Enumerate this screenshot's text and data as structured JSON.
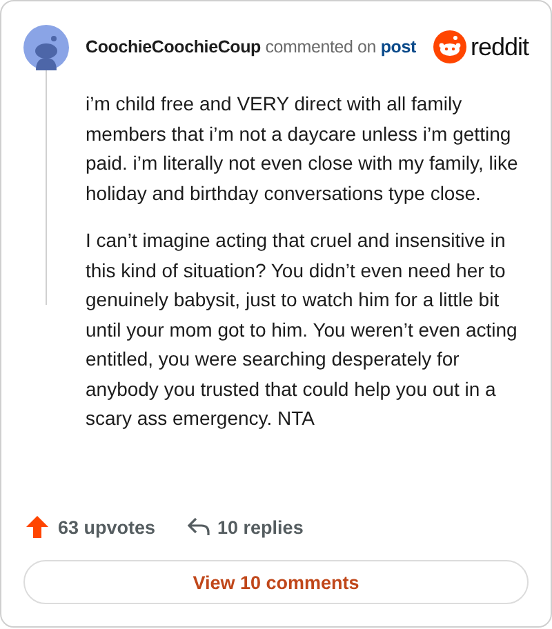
{
  "comment": {
    "author": "CoochieCoochieCoup",
    "action": "commented on",
    "link": "post",
    "brand": "reddit",
    "paragraphs": [
      "i’m child free and VERY direct with all family members that i’m not a daycare unless i’m getting paid. i’m literally not even close with my family, like holiday and birthday conversations type close.",
      "I can’t imagine acting that cruel and insensitive in this kind of situation? You didn’t even need her to genuinely babysit, just to watch him for a little bit until your mom got to him. You weren’t even acting entitled, you were searching desperately for anybody you trusted that could help you out in a scary ass emergency. NTA"
    ],
    "upvotes": "63 upvotes",
    "replies": "10 replies",
    "view_button": "View 10 comments"
  }
}
